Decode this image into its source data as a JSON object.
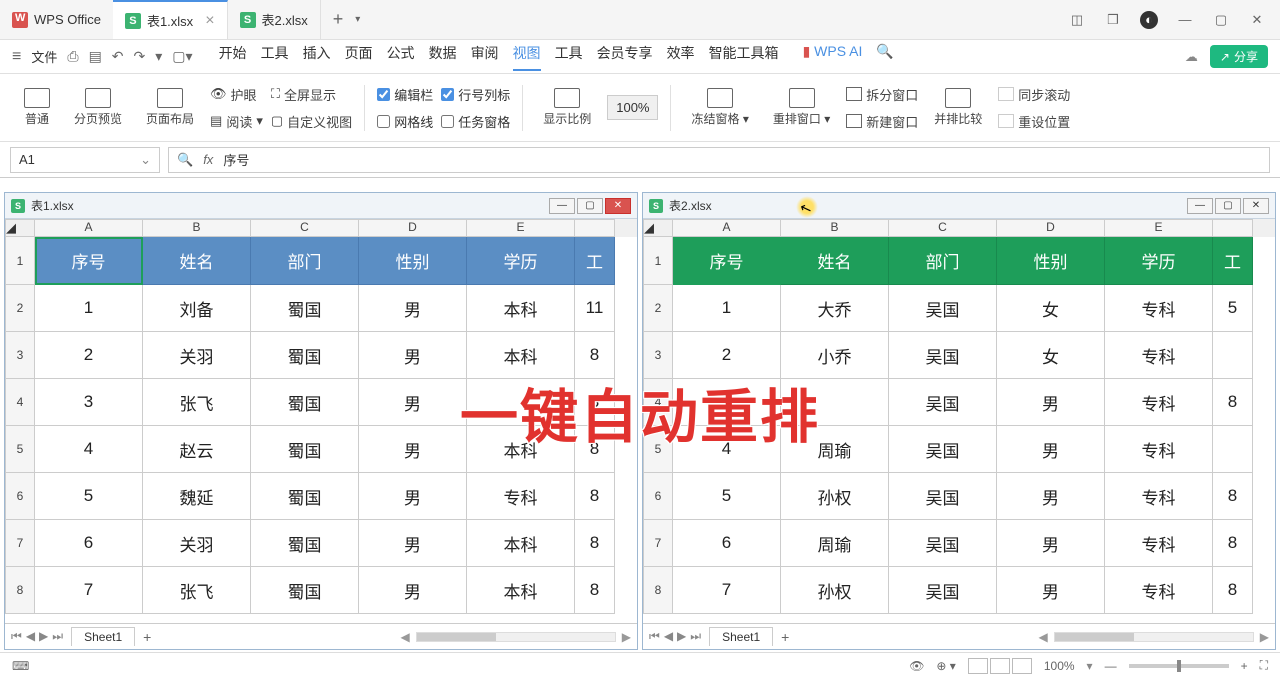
{
  "app": {
    "name": "WPS Office"
  },
  "tabs": [
    {
      "label": "表1.xlsx",
      "active": true
    },
    {
      "label": "表2.xlsx",
      "active": false
    }
  ],
  "menubar": {
    "file": "文件",
    "items": [
      "开始",
      "工具",
      "插入",
      "页面",
      "公式",
      "数据",
      "审阅",
      "视图",
      "工具",
      "会员专享",
      "效率",
      "智能工具箱"
    ],
    "active_index": 7,
    "ai": "WPS AI",
    "share": "分享"
  },
  "ribbon": {
    "view_modes": {
      "normal": "普通",
      "page_preview": "分页预览",
      "page_layout": "页面布局"
    },
    "protect_eye": "护眼",
    "read": "阅读",
    "fullscreen": "全屏显示",
    "custom_view": "自定义视图",
    "checks": {
      "edit_bar": "编辑栏",
      "row_col_label": "行号列标",
      "gridlines": "网格线",
      "task_pane": "任务窗格"
    },
    "zoom_ratio": "显示比例",
    "zoom_value": "100%",
    "freeze": "冻结窗格",
    "rearrange": "重排窗口",
    "split_window": "拆分窗口",
    "new_window": "新建窗口",
    "side_by_side": "并排比较",
    "sync_scroll": "同步滚动",
    "reset_position": "重设位置"
  },
  "formula_bar": {
    "cell_ref": "A1",
    "cell_value": "序号"
  },
  "workbook1": {
    "filename": "表1.xlsx",
    "columns": [
      "A",
      "B",
      "C",
      "D",
      "E"
    ],
    "header_last": "工",
    "headers": [
      "序号",
      "姓名",
      "部门",
      "性别",
      "学历"
    ],
    "rows": [
      [
        "1",
        "刘备",
        "蜀国",
        "男",
        "本科",
        "11"
      ],
      [
        "2",
        "关羽",
        "蜀国",
        "男",
        "本科",
        "8"
      ],
      [
        "3",
        "张飞",
        "蜀国",
        "男",
        "",
        "8"
      ],
      [
        "4",
        "赵云",
        "蜀国",
        "男",
        "本科",
        "8"
      ],
      [
        "5",
        "魏延",
        "蜀国",
        "男",
        "专科",
        "8"
      ],
      [
        "6",
        "关羽",
        "蜀国",
        "男",
        "本科",
        "8"
      ],
      [
        "7",
        "张飞",
        "蜀国",
        "男",
        "本科",
        "8"
      ]
    ],
    "sheet_name": "Sheet1"
  },
  "workbook2": {
    "filename": "表2.xlsx",
    "columns": [
      "A",
      "B",
      "C",
      "D",
      "E"
    ],
    "header_last": "工",
    "headers": [
      "序号",
      "姓名",
      "部门",
      "性别",
      "学历"
    ],
    "rows": [
      [
        "1",
        "大乔",
        "吴国",
        "女",
        "专科",
        "5"
      ],
      [
        "2",
        "小乔",
        "吴国",
        "女",
        "专科",
        ""
      ],
      [
        "3",
        "",
        "吴国",
        "男",
        "专科",
        "8"
      ],
      [
        "4",
        "周瑜",
        "吴国",
        "男",
        "专科",
        ""
      ],
      [
        "5",
        "孙权",
        "吴国",
        "男",
        "专科",
        "8"
      ],
      [
        "6",
        "周瑜",
        "吴国",
        "男",
        "专科",
        "8"
      ],
      [
        "7",
        "孙权",
        "吴国",
        "男",
        "专科",
        "8"
      ]
    ],
    "sheet_name": "Sheet1"
  },
  "overlay": {
    "text": "一键自动重排"
  },
  "statusbar": {
    "zoom": "100%"
  }
}
